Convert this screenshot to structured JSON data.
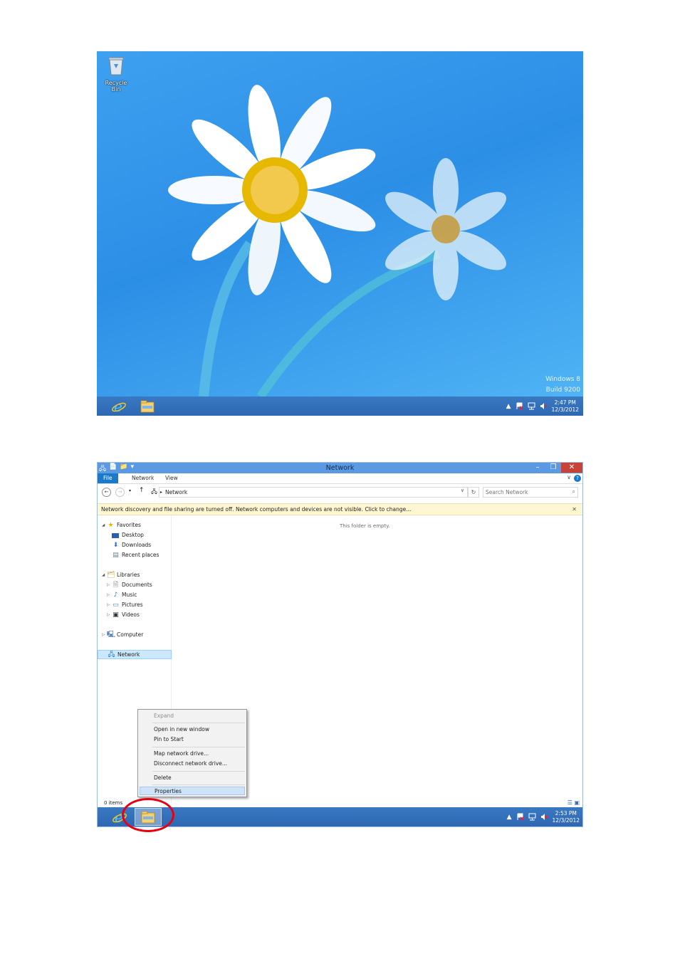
{
  "desktop": {
    "recycle_bin_label": "Recycle Bin",
    "watermark_line1": "Windows 8",
    "watermark_line2": "Build 9200",
    "taskbar": {
      "pinned": [
        "internet-explorer-icon",
        "file-explorer-icon"
      ],
      "tray_icons": [
        "show-hidden-icons-icon",
        "action-center-icon",
        "network-icon",
        "volume-muted-icon"
      ],
      "show_hidden": "▲",
      "time": "2:47 PM",
      "date": "12/3/2012"
    }
  },
  "explorer": {
    "title": "Network",
    "ribbon_tabs": [
      "File",
      "Network",
      "View"
    ],
    "help": "?",
    "address_path": "Network",
    "search_placeholder": "Search Network",
    "infobar_message": "Network discovery and file sharing are turned off. Network computers and devices are not visible. Click to change...",
    "empty_message": "This folder is empty.",
    "nav": {
      "favorites": "Favorites",
      "desktop": "Desktop",
      "downloads": "Downloads",
      "recent_places": "Recent places",
      "libraries": "Libraries",
      "documents": "Documents",
      "music": "Music",
      "pictures": "Pictures",
      "videos": "Videos",
      "computer": "Computer",
      "network": "Network"
    },
    "context_menu": {
      "expand": "Expand",
      "open_new_window": "Open in new window",
      "pin_to_start": "Pin to Start",
      "map_network_drive": "Map network drive...",
      "disconnect_network_drive": "Disconnect network drive...",
      "delete": "Delete",
      "properties": "Properties"
    },
    "status_items": "0 items",
    "taskbar": {
      "time": "2:53 PM",
      "date": "12/3/2012"
    }
  },
  "colors": {
    "desktop_bg": "#2c8fe6",
    "taskbar": "#2e68b3",
    "titlebar": "#5b9ae3",
    "close_button": "#c7433a",
    "infobar": "#fff7d1",
    "highlight_ring": "#e60012"
  }
}
